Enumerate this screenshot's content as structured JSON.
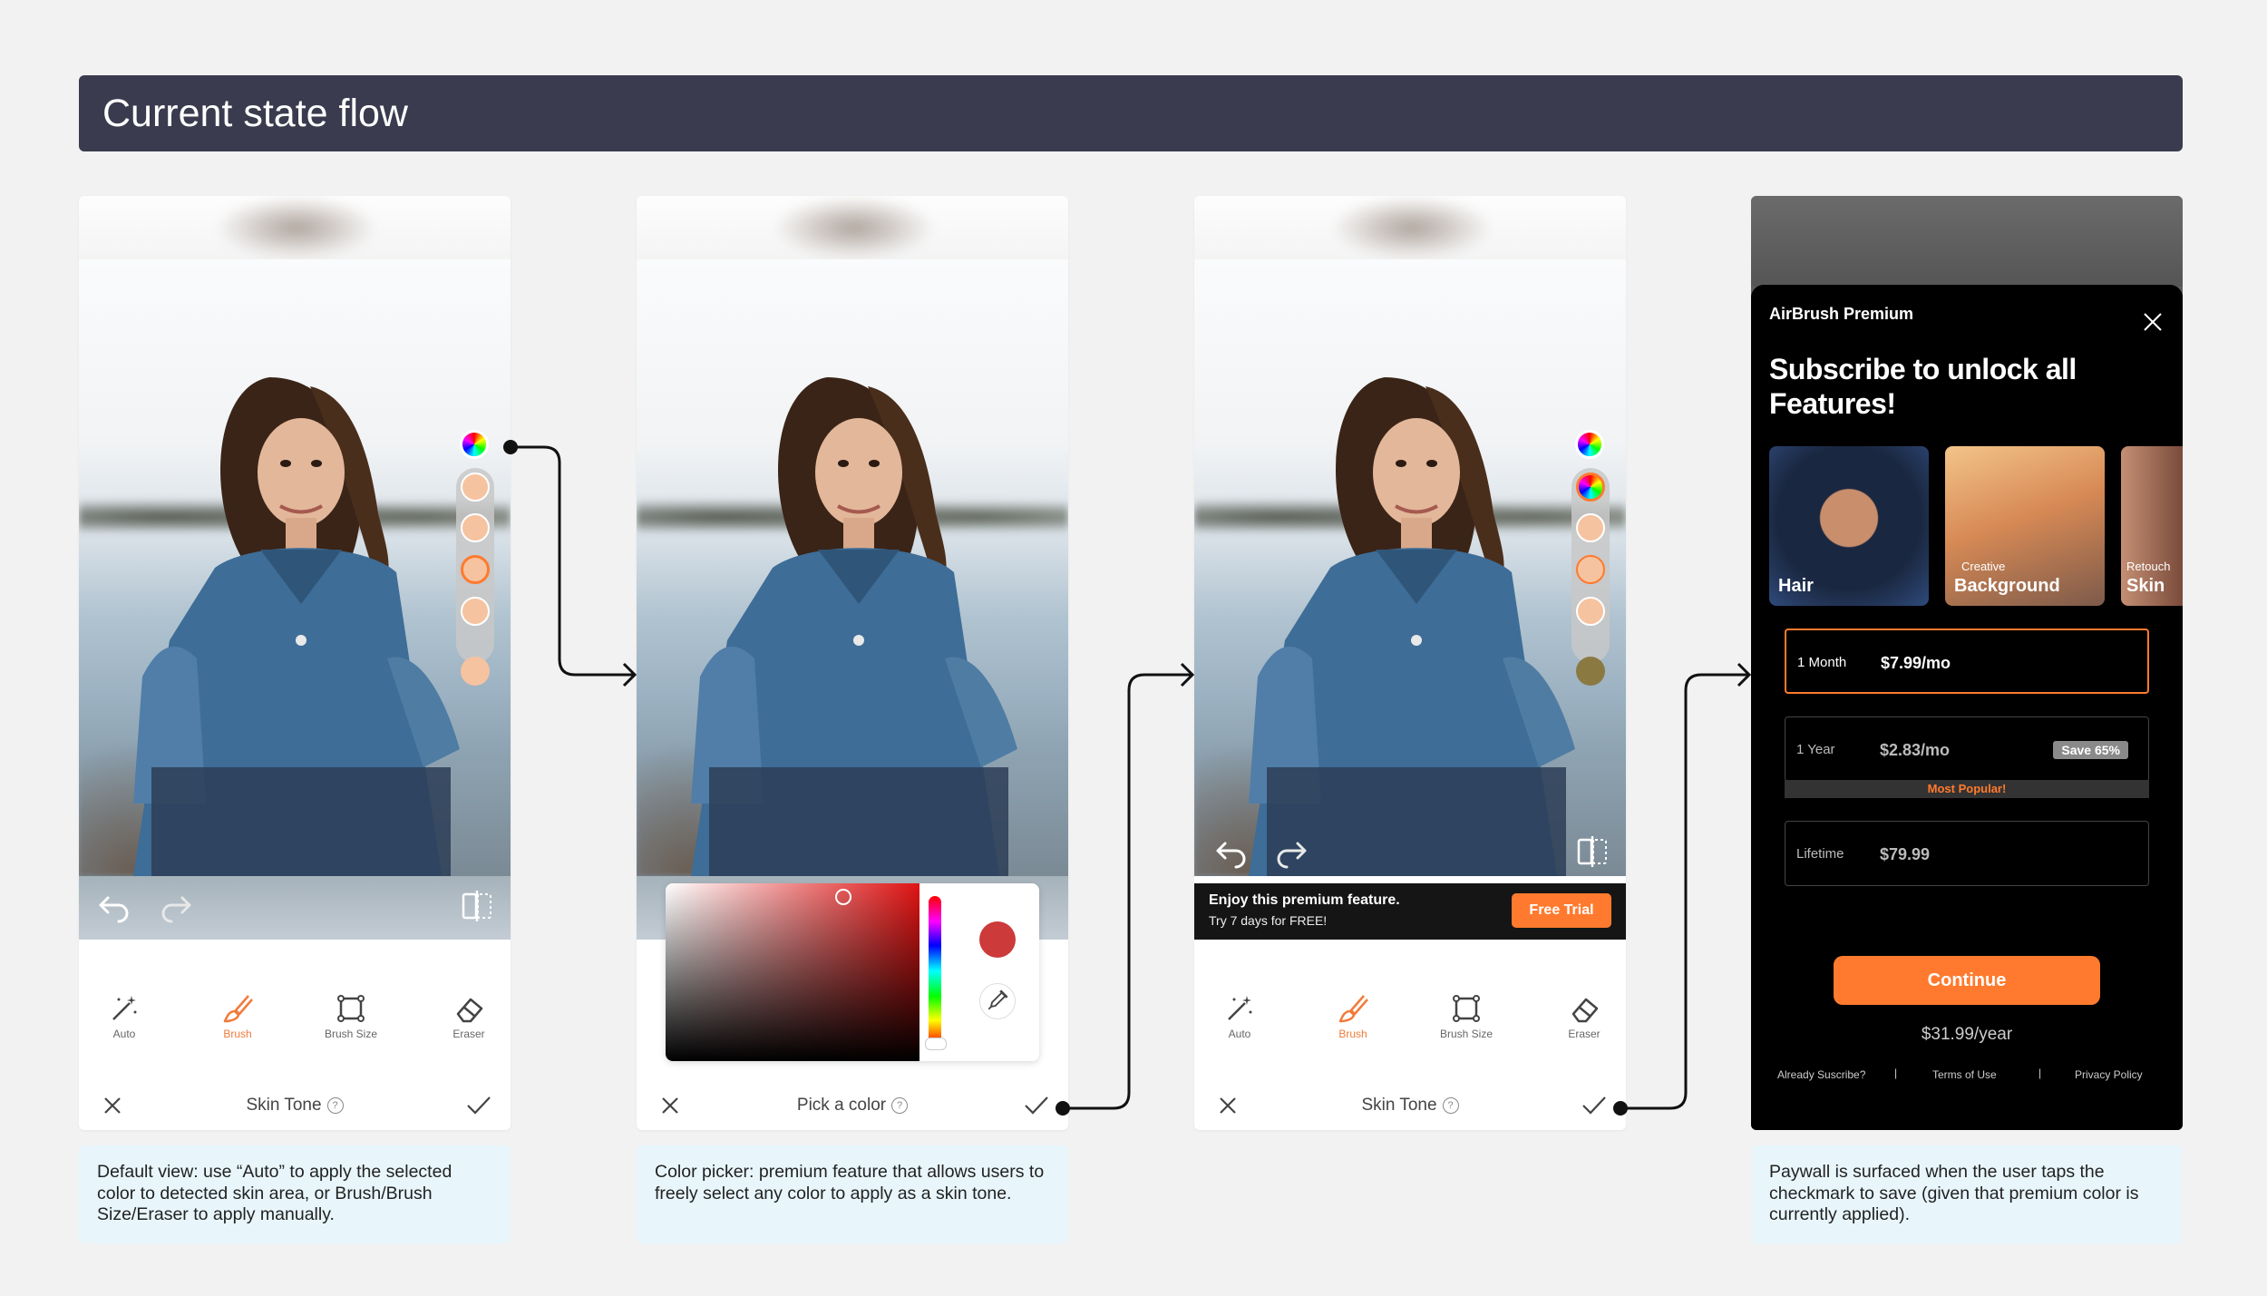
{
  "header": {
    "title": "Current state flow"
  },
  "screens": [
    {
      "tools": [
        {
          "label": "Auto",
          "icon": "magic-wand-icon"
        },
        {
          "label": "Brush",
          "icon": "brush-icon"
        },
        {
          "label": "Brush Size",
          "icon": "brush-size-icon"
        },
        {
          "label": "Eraser",
          "icon": "eraser-icon"
        }
      ],
      "footer_label": "Skin Tone",
      "caption": "Default view: use “Auto” to apply the selected color to detected skin area, or Brush/Brush Size/Eraser to apply manually.",
      "swatches": [
        "#f6c3a0",
        "#f6c3a0",
        "#f6c3a0",
        "#f6c3a0",
        "#f6c3a0"
      ]
    },
    {
      "footer_label": "Pick a color",
      "caption": "Color picker: premium feature that allows users to freely select any color to apply as a skin tone.",
      "picked_color": "#cc3a3a"
    },
    {
      "tools": [
        {
          "label": "Auto",
          "icon": "magic-wand-icon"
        },
        {
          "label": "Brush",
          "icon": "brush-icon"
        },
        {
          "label": "Brush Size",
          "icon": "brush-size-icon"
        },
        {
          "label": "Eraser",
          "icon": "eraser-icon"
        }
      ],
      "footer_label": "Skin Tone",
      "premium_banner": {
        "title": "Enjoy this premium feature.",
        "subtitle": "Try 7 days for FREE!",
        "button": "Free Trial"
      },
      "swatches": [
        "#f6c3a0",
        "#f6c3a0",
        "#f6c3a0",
        "#8a7a42"
      ]
    },
    {
      "brand": "AirBrush Premium",
      "title": "Subscribe to unlock all Features!",
      "features": [
        {
          "label": "Hair",
          "sub": ""
        },
        {
          "label": "Background",
          "sub": "Creative"
        },
        {
          "label": "Skin",
          "sub": "Retouch"
        }
      ],
      "plans": [
        {
          "term": "1 Month",
          "price": "$7.99/mo",
          "badge": "",
          "selected": true
        },
        {
          "term": "1 Year",
          "price": "$2.83/mo",
          "badge": "Save 65%",
          "selected": false
        },
        {
          "term": "Lifetime",
          "price": "$79.99",
          "badge": "",
          "selected": false
        }
      ],
      "most_popular": "Most Popular!",
      "continue": "Continue",
      "after_price": "$31.99/year",
      "links": [
        "Already Suscribe?",
        "Terms of Use",
        "Privacy Policy"
      ],
      "caption": "Paywall is surfaced when the user taps the checkmark to save (given that premium color is currently applied)."
    }
  ],
  "colors": {
    "accent": "#ff7a2e",
    "header_bg": "#3a3b4e",
    "caption_bg": "#e8f6fb"
  }
}
